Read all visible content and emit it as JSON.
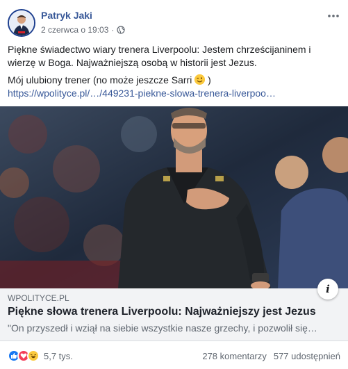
{
  "post": {
    "author": "Patryk Jaki",
    "timestamp": "2 czerwca o 19:03",
    "privacy_icon": "globe-icon",
    "more_icon": "more-options-icon",
    "paragraph1": "Piękne świadectwo wiary trenera Liverpoolu: Jestem chrześcijaninem i wierzę w Boga. Najważniejszą osobą w historii jest Jezus.",
    "paragraph2_text": "Mój ulubiony trener (no może jeszcze Sarri",
    "paragraph2_end": ")",
    "emoji": "wink-emoji-icon",
    "link_url": "https://wpolityce.pl/…/449231-piekne-slowa-trenera-liverpoo…"
  },
  "preview": {
    "domain": "WPOLITYCE.PL",
    "title": "Piękne słowa trenera Liverpoolu: Najważniejszy jest Jezus",
    "description": "\"On przyszedł i wziął na siebie wszystkie nasze grzechy, i pozwolił się…",
    "info_icon": "info-icon",
    "info_label": "i"
  },
  "footer": {
    "reactions": [
      "like-reaction-icon",
      "love-reaction-icon",
      "haha-reaction-icon"
    ],
    "reaction_count": "5,7 tys.",
    "comments": "278 komentarzy",
    "shares": "577 udostępnień"
  },
  "colors": {
    "link": "#385898",
    "like": "#1877f2",
    "love": "#f33e58",
    "haha": "#fbc93d",
    "preview_bg": "#f2f3f5"
  }
}
